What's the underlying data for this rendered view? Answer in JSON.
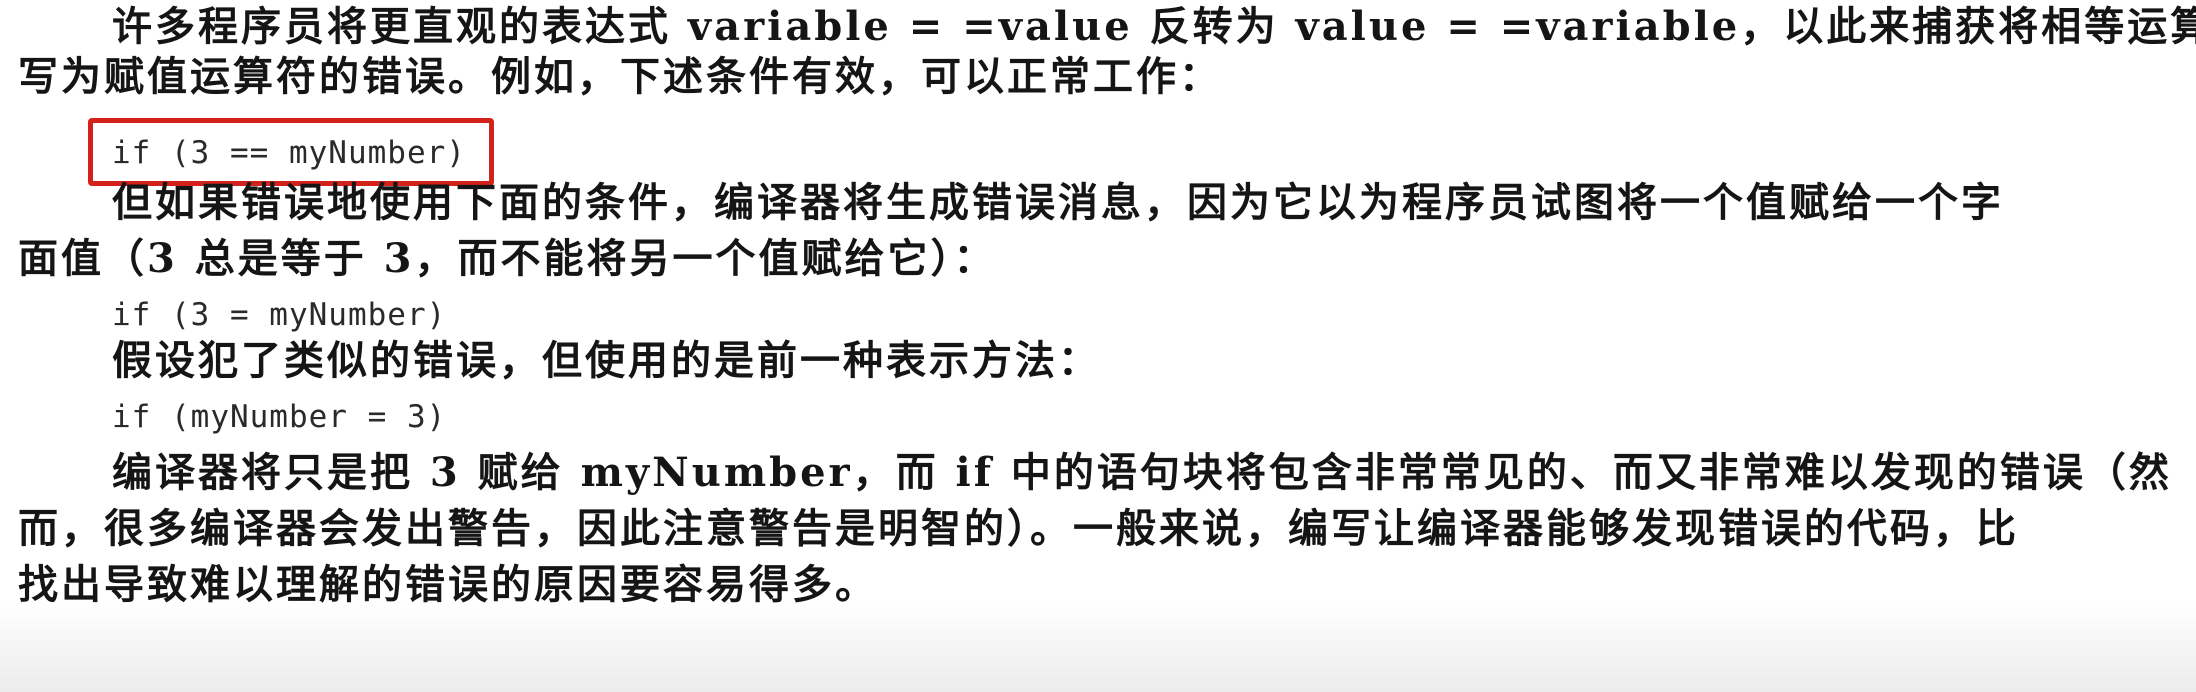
{
  "document": {
    "lines": [
      "许多程序员将更直观的表达式 variable = =value 反转为 value = =variable，以此来捕获将相等运算符误",
      "写为赋值运算符的错误。例如，下述条件有效，可以正常工作：",
      "if (3 == myNumber)",
      "但如果错误地使用下面的条件，编译器将生成错误消息，因为它以为程序员试图将一个值赋给一个字",
      "面值（3 总是等于 3，而不能将另一个值赋给它）：",
      "if (3 = myNumber)",
      "假设犯了类似的错误，但使用的是前一种表示方法：",
      "if (myNumber = 3)",
      "编译器将只是把 3 赋给 myNumber，而 if 中的语句块将包含非常常见的、而又非常难以发现的错误（然",
      "而，很多编译器会发出警告，因此注意警告是明智的）。一般来说，编写让编译器能够发现错误的代码，比",
      "找出导致难以理解的错误的原因要容易得多。"
    ]
  },
  "colors": {
    "text": "#151515",
    "code_text": "#2a2a2a",
    "highlight_border": "#d3211b"
  }
}
